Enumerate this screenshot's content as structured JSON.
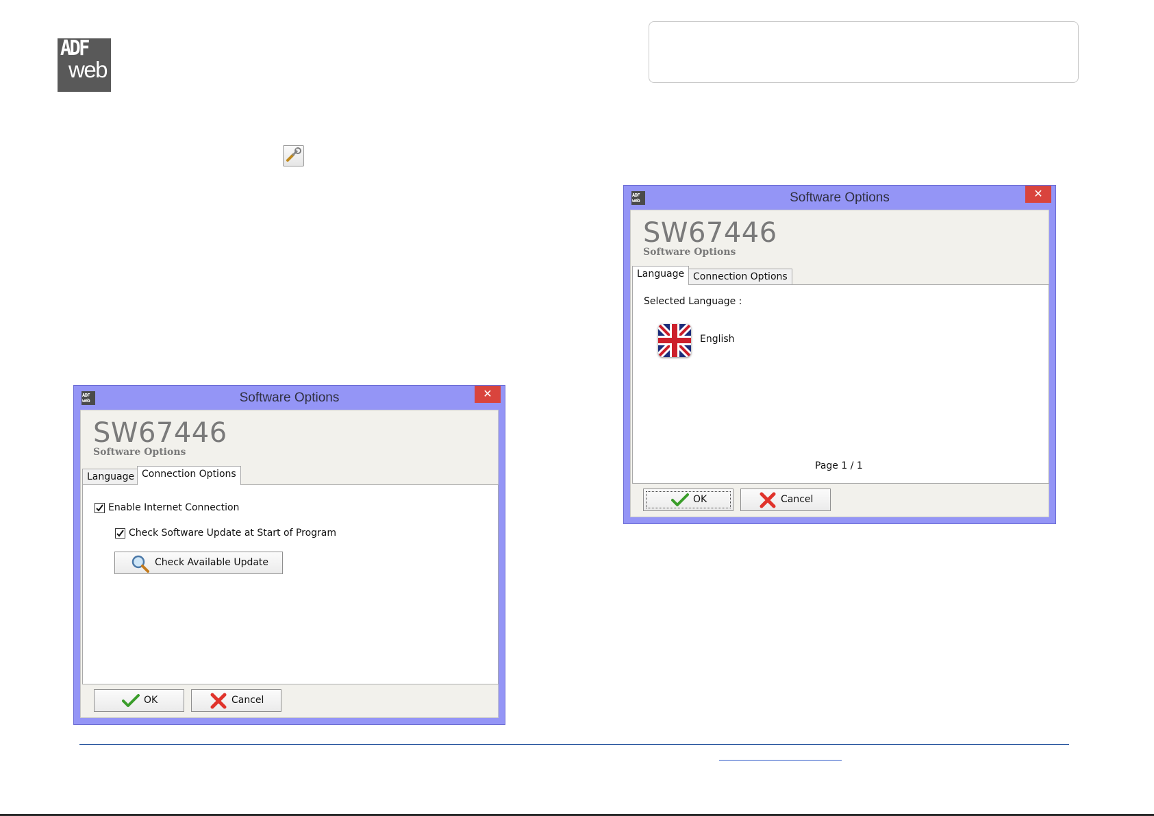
{
  "logo": {
    "line1": "ADF",
    "line2": "web"
  },
  "dialogs": {
    "connection": {
      "window_title": "Software Options",
      "app_icon_text": "ADF web",
      "close_glyph": "✕",
      "product_code": "SW67446",
      "subtitle": "Software Options",
      "tabs": [
        "Language",
        "Connection Options"
      ],
      "active_tab": "Connection Options",
      "enable_internet_label": "Enable Internet Connection",
      "enable_internet_checked": true,
      "check_update_label": "Check Software Update at Start of Program",
      "check_update_checked": true,
      "check_available_update_label": "Check Available Update",
      "ok_label": "OK",
      "cancel_label": "Cancel"
    },
    "language": {
      "window_title": "Software Options",
      "app_icon_text": "ADF web",
      "close_glyph": "✕",
      "product_code": "SW67446",
      "subtitle": "Software Options",
      "tabs": [
        "Language",
        "Connection Options"
      ],
      "active_tab": "Language",
      "selected_language_label": "Selected Language :",
      "language_name": "English",
      "page_indicator": "Page 1 / 1",
      "ok_label": "OK",
      "cancel_label": "Cancel"
    }
  },
  "colors": {
    "window_frame": "#9495f6",
    "close_button": "#d9443d",
    "client_bg": "#f2f1ec",
    "footer_rule": "#1f4e9a"
  },
  "icons": [
    "adf-web-logo",
    "wrench-icon",
    "magnifier-icon",
    "ok-check-icon",
    "cancel-x-icon",
    "uk-flag-icon",
    "close-icon"
  ]
}
